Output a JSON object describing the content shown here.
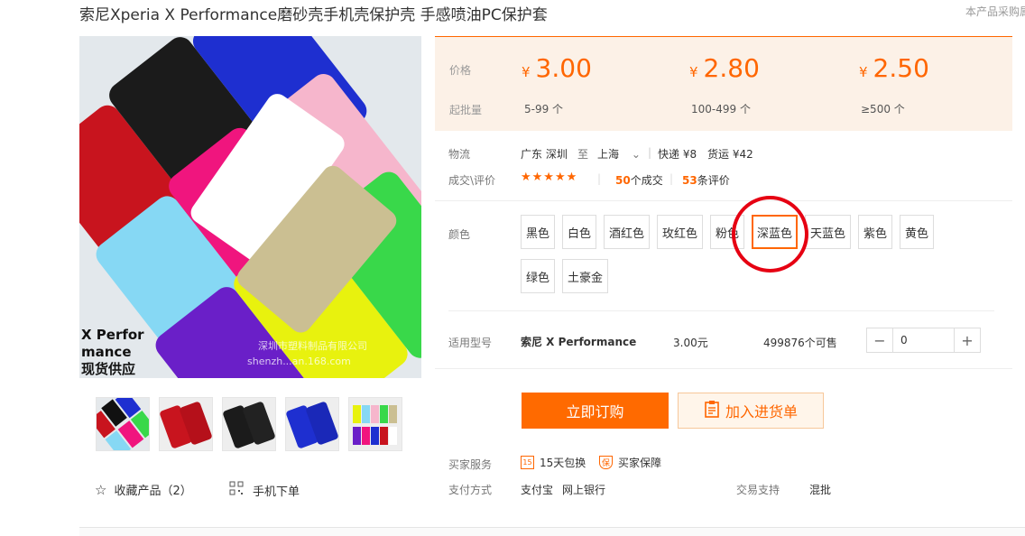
{
  "header": {
    "title": "索尼Xperia X Performance磨砂壳手机壳保护壳 手感喷油PC保护套",
    "note": "本产品采购属"
  },
  "image": {
    "overlay_text_line1": "X Perfor",
    "overlay_text_line2": "mance",
    "overlay_text_line3": "现货供应",
    "watermark_line1": "深圳市塑料制品有限公司",
    "watermark_line2": "shenzh...an.168.com"
  },
  "actions": {
    "favorite": "收藏产品（2）",
    "mobile_order": "手机下单"
  },
  "price": {
    "price_label": "价格",
    "moq_label": "起批量",
    "currency": "¥",
    "tiers": [
      {
        "price": "3.00",
        "qty": "5-99 个"
      },
      {
        "price": "2.80",
        "qty": "100-499 个"
      },
      {
        "price": "2.50",
        "qty": "≥500 个"
      }
    ]
  },
  "logistics": {
    "label": "物流",
    "from": "广东 深圳",
    "to_word": "至",
    "to": "上海",
    "express": "快递 ¥8",
    "freight": "货运 ¥42"
  },
  "deals": {
    "label": "成交\\评价",
    "stars": "★★★★★",
    "count": "50",
    "count_suffix": "个成交",
    "reviews": "53",
    "reviews_suffix": "条评价"
  },
  "colors": {
    "label": "颜色",
    "options": [
      "黑色",
      "白色",
      "酒红色",
      "玫红色",
      "粉色",
      "深蓝色",
      "天蓝色",
      "紫色",
      "黄色",
      "绿色",
      "土豪金"
    ],
    "selected": "深蓝色"
  },
  "model": {
    "label": "适用型号",
    "name": "索尼 X Performance",
    "price": "3.00元",
    "stock": "499876个可售",
    "quantity": "0",
    "minus": "−",
    "plus": "+"
  },
  "buttons": {
    "buy": "立即订购",
    "cart": "加入进货单"
  },
  "service": {
    "label": "买家服务",
    "return_icon": "15",
    "return": "15天包换",
    "guarantee_icon": "保",
    "guarantee": "买家保障"
  },
  "payment": {
    "label": "支付方式",
    "methods": [
      "支付宝",
      "网上银行"
    ],
    "support_label": "交易支持",
    "support": "混批"
  },
  "theme": {
    "accent": "#ff6600",
    "price_bg": "#fcf1e7",
    "highlight_circle": "#e60012"
  }
}
